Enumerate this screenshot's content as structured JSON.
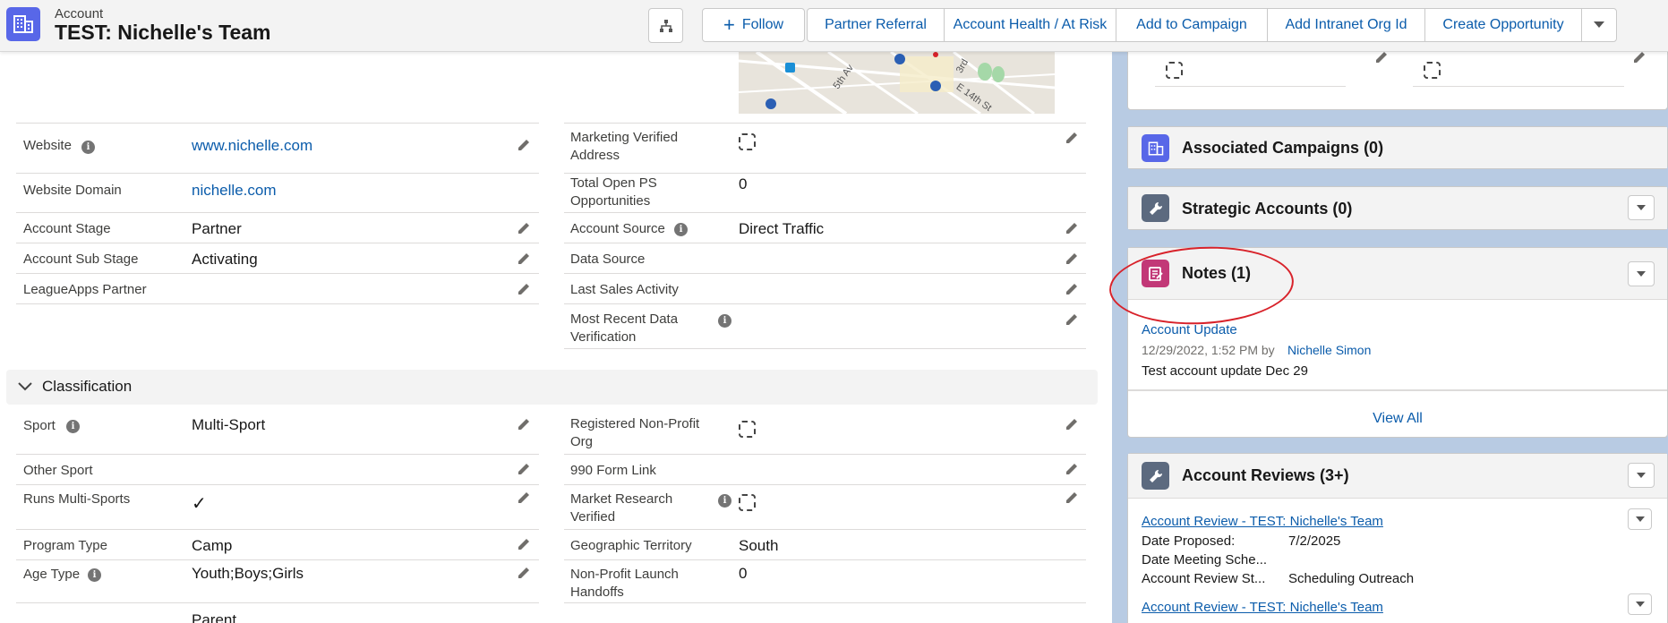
{
  "header": {
    "object_type": "Account",
    "record_title": "TEST: Nichelle's Team",
    "buttons": {
      "follow": "Follow",
      "partner_referral": "Partner Referral",
      "account_health": "Account Health / At Risk",
      "add_to_campaign": "Add to Campaign",
      "add_intranet": "Add Intranet Org Id",
      "create_opportunity": "Create Opportunity"
    }
  },
  "map": {
    "labels": [
      "5th Av",
      "3rd",
      "E 14th St"
    ]
  },
  "fields_left": [
    {
      "label": "Website",
      "value": "www.nichelle.com"
    },
    {
      "label": "Website Domain",
      "value": "nichelle.com"
    },
    {
      "label": "Account Stage",
      "value": "Partner"
    },
    {
      "label": "Account Sub Stage",
      "value": "Activating"
    },
    {
      "label": "LeagueApps Partner",
      "value": ""
    }
  ],
  "fields_right": [
    {
      "label": "Marketing Verified Address",
      "value": ""
    },
    {
      "label": "Total Open PS Opportunities",
      "value": "0"
    },
    {
      "label": "Account Source",
      "value": "Direct Traffic"
    },
    {
      "label": "Data Source",
      "value": ""
    },
    {
      "label": "Last Sales Activity",
      "value": ""
    },
    {
      "label": "Most Recent Data Verification",
      "value": ""
    }
  ],
  "classification": {
    "title": "Classification",
    "left": [
      {
        "label": "Sport",
        "value": "Multi-Sport"
      },
      {
        "label": "Other Sport",
        "value": ""
      },
      {
        "label": "Runs Multi-Sports",
        "value": "✓"
      },
      {
        "label": "Program Type",
        "value": "Camp"
      },
      {
        "label": "Age Type",
        "value": "Youth;Boys;Girls"
      }
    ],
    "right": [
      {
        "label": "Registered Non-Profit Org",
        "value": ""
      },
      {
        "label": "990 Form Link",
        "value": ""
      },
      {
        "label": "Market Research Verified",
        "value": ""
      },
      {
        "label": "Geographic Territory",
        "value": "South"
      },
      {
        "label": "Non-Profit Launch Handoffs",
        "value": "0"
      }
    ],
    "partial_value": "Parent"
  },
  "sidebar": {
    "associated_campaigns": "Associated Campaigns (0)",
    "strategic_accounts": "Strategic Accounts (0)",
    "notes": {
      "title": "Notes (1)",
      "note_title": "Account Update",
      "note_meta": "12/29/2022, 1:52 PM by",
      "note_author": "Nichelle Simon",
      "note_body": "Test account update Dec 29",
      "view_all": "View All"
    },
    "account_reviews": {
      "title": "Account Reviews (3+)",
      "review_1": {
        "link": "Account Review - TEST: Nichelle's Team",
        "rows": [
          {
            "label": "Date Proposed:",
            "value": "7/2/2025"
          },
          {
            "label": "Date Meeting Sche...",
            "value": ""
          },
          {
            "label": "Account Review St...",
            "value": "Scheduling Outreach"
          }
        ]
      },
      "review_2_link": "Account Review - TEST: Nichelle's Team"
    }
  },
  "colors": {
    "brand_blue": "#0b5cab",
    "account_icon": "#5867e8",
    "notes_icon": "#c23877",
    "wrench_icon": "#5c6a7f",
    "annotation_red": "#d8222a"
  }
}
